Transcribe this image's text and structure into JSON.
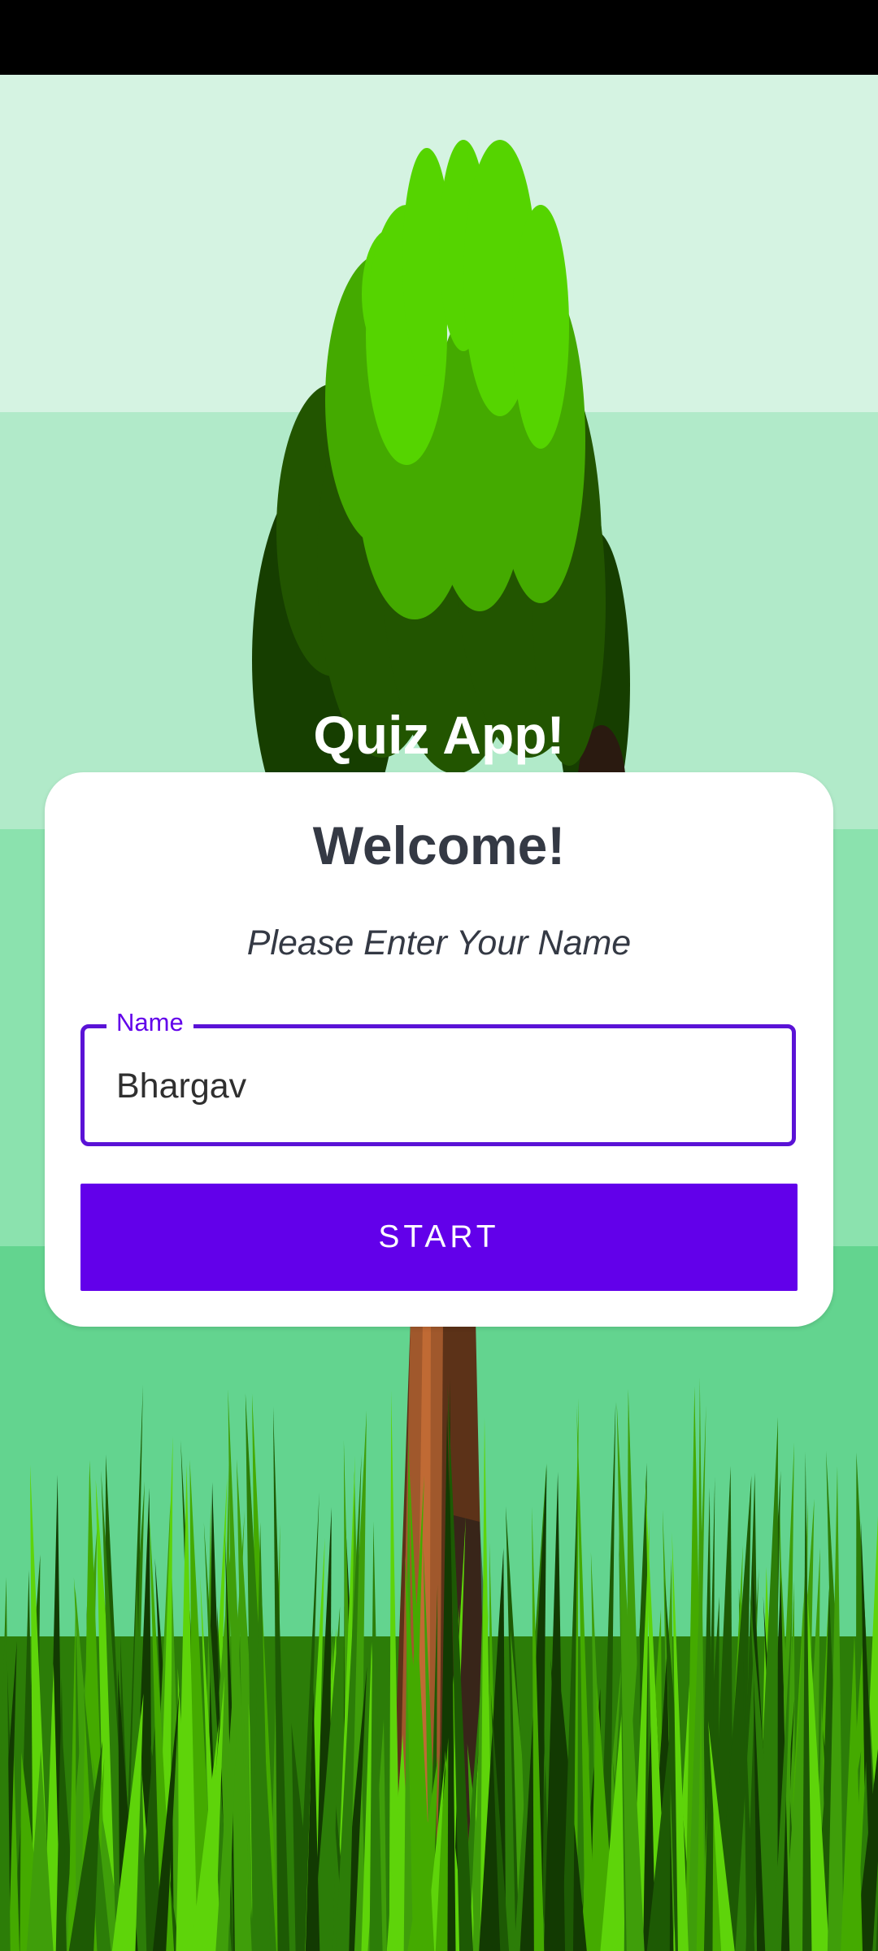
{
  "app": {
    "title": "Quiz App!"
  },
  "card": {
    "title": "Welcome!",
    "subtitle": "Please Enter Your Name",
    "name_field": {
      "label": "Name",
      "value": "Bhargav"
    },
    "start_label": "START"
  },
  "colors": {
    "accent": "#6200ea",
    "card_text": "#343944",
    "sky_band_1": "#d5f3e2",
    "sky_band_2": "#b1eac9",
    "sky_band_3": "#8be2ae",
    "sky_band_4": "#63d48f",
    "grass_dark": "#2c7d08",
    "grass_light": "#5ed40a",
    "leaf_light": "#55d400",
    "leaf_mid": "#44aa00",
    "leaf_dark": "#225500",
    "trunk": "#a0582c"
  }
}
